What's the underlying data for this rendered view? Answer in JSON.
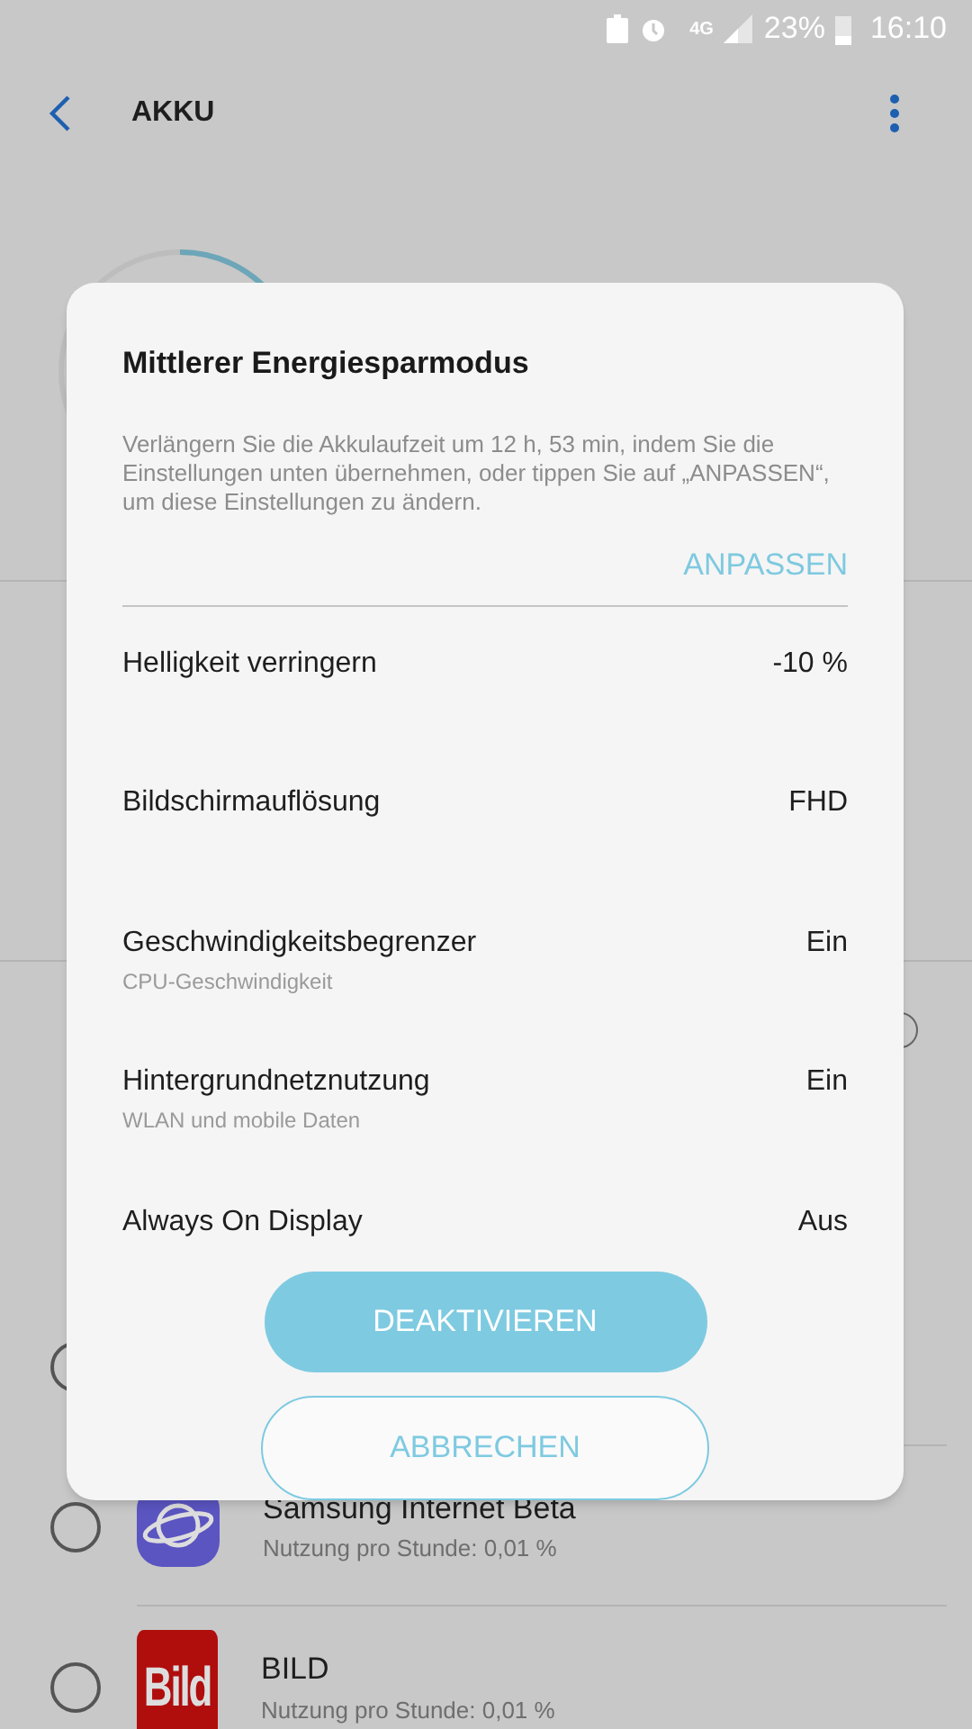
{
  "status_bar": {
    "network": "4G",
    "battery": "23%",
    "time": "16:10"
  },
  "header": {
    "title": "AKKU"
  },
  "background": {
    "section_3": {
      "selected": false
    },
    "apps": [
      {
        "selected": false
      },
      {
        "name": "Samsung Internet Beta",
        "usage": "Nutzung pro Stunde: 0,01 %",
        "selected": false,
        "kind": "browser"
      },
      {
        "name": "BILD",
        "usage": "Nutzung pro Stunde: 0,01 %",
        "selected": false,
        "kind": "logo",
        "logo_text": "Bild"
      }
    ]
  },
  "dialog": {
    "title": "Mittlerer Energiesparmodus",
    "description": "Verlängern Sie die Akkulaufzeit um 12 h, 53 min, indem Sie die Einstellungen unten übernehmen, oder tippen Sie auf „ANPASSEN“, um diese Einstellungen zu ändern.",
    "link": "ANPASSEN",
    "settings": [
      {
        "label": "Helligkeit verringern",
        "value": "-10 %"
      },
      {
        "label": "Bildschirmauflösung",
        "value": "FHD"
      },
      {
        "label": "Geschwindigkeitsbegrenzer",
        "subtitle": "CPU-Geschwindigkeit",
        "value": "Ein"
      },
      {
        "label": "Hintergrundnetznutzung",
        "subtitle": "WLAN und mobile Daten",
        "value": "Ein"
      },
      {
        "label": "Always On Display",
        "value": "Aus"
      }
    ],
    "primary_button": "DEAKTIVIEREN",
    "secondary_button": "ABBRECHEN"
  }
}
